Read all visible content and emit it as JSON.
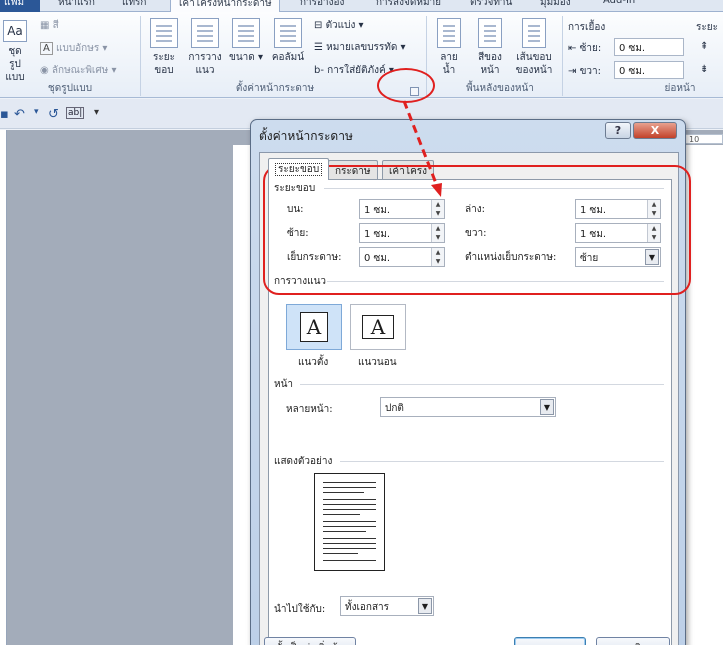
{
  "ribbon": {
    "tabs": [
      "แฟ้ม",
      "หน้าแรก",
      "แทรก",
      "เค้าโครงหน้ากระดาษ",
      "การอ้างอิง",
      "การส่งจดหมาย",
      "ตรวจทาน",
      "มุมมอง",
      "Add-In"
    ],
    "themes": {
      "btn": "ชุด\nรูปแบบ",
      "colors": "สี",
      "fonts": "แบบอักษร",
      "effects": "ลักษณะพิเศษ",
      "label": "ชุดรูปแบบ"
    },
    "page_setup": {
      "margins": "ระยะ\nขอบ",
      "orientation": "การวาง\nแนว",
      "size": "ขนาด",
      "columns": "คอลัมน์",
      "breaks": "ตัวแบ่ง",
      "line_numbers": "หมายเลขบรรทัด",
      "hyphenation": "การใส่ยัติภังค์",
      "label": "ตั้งค่าหน้ากระดาษ"
    },
    "page_background": {
      "watermark": "ลาย\nน้ำ",
      "page_color": "สีของ\nหน้า",
      "page_borders": "เส้นขอบ\nของหน้า",
      "label": "พื้นหลังของหน้า"
    },
    "indent": {
      "title": "การเยื้อง",
      "left_label": "ซ้าย:",
      "left_value": "0 ซม.",
      "right_label": "ขวา:",
      "right_value": "0 ซม."
    },
    "spacing": {
      "title": "ระยะ",
      "label": "ย่อหน้า"
    }
  },
  "ruler": {
    "number": "10"
  },
  "dialog": {
    "title": "ตั้งค่าหน้ากระดาษ",
    "help": "?",
    "close": "X",
    "tabs": [
      "ระยะขอบ",
      "กระดาษ",
      "เค้าโครง"
    ],
    "margins_section": "ระยะขอบ",
    "fields": {
      "top_label": "บน:",
      "top_value": "1 ซม.",
      "bottom_label": "ล่าง:",
      "bottom_value": "1 ซม.",
      "left_label": "ซ้าย:",
      "left_value": "1 ซม.",
      "right_label": "ขวา:",
      "right_value": "1 ซม.",
      "gutter_label": "เย็บกระดาษ:",
      "gutter_value": "0 ซม.",
      "gutter_pos_label": "ตำแหน่งเย็บกระดาษ:",
      "gutter_pos_value": "ซ้าย"
    },
    "orientation_section": "การวางแนว",
    "portrait": "แนวตั้ง",
    "landscape": "แนวนอน",
    "pages_section": "หน้า",
    "multiple_pages_label": "หลายหน้า:",
    "multiple_pages_value": "ปกติ",
    "preview_section": "แสดงตัวอย่าง",
    "apply_to_label": "นำไปใช้กับ:",
    "apply_to_value": "ทั้งเอกสาร",
    "set_default": "ตั้งเป็นค่าเริ่มต้น",
    "ok": "ตกลง",
    "cancel": "ยกเลิก"
  },
  "colors": {
    "annotation": "#e0201f",
    "accent": "#2b5797"
  }
}
